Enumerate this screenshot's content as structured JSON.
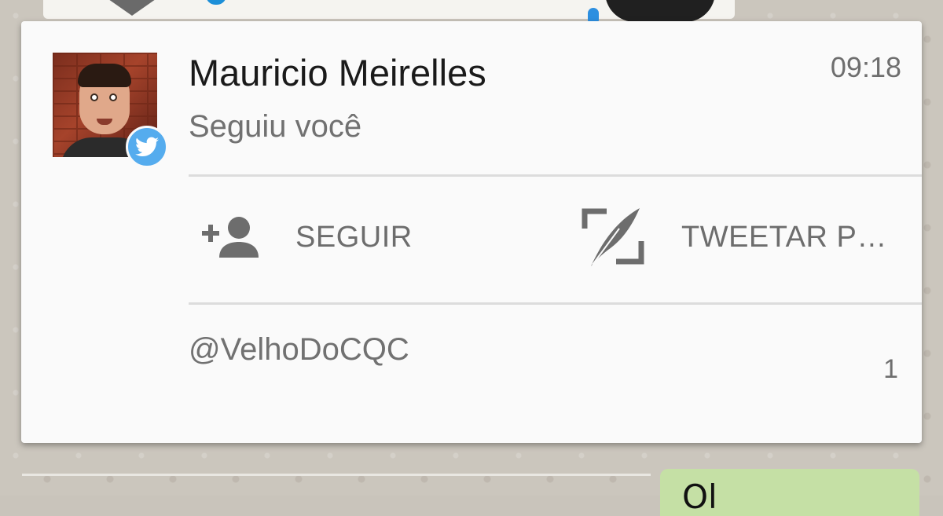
{
  "notification": {
    "title": "Mauricio Meirelles",
    "time": "09:18",
    "subtitle": "Seguiu você",
    "handle": "@VelhoDoCQC",
    "count": "1",
    "app_badge_icon": "twitter-bird-icon",
    "avatar_icon": "profile-photo"
  },
  "actions": [
    {
      "label": "SEGUIR",
      "icon": "add-person-icon"
    },
    {
      "label": "TWEETAR P…",
      "icon": "compose-quill-icon"
    }
  ],
  "background": {
    "bubble_text": "Ol"
  },
  "colors": {
    "card_bg": "#fafafa",
    "twitter_blue": "#55acee",
    "title_text": "#1a1a1a",
    "secondary_text": "#717171",
    "icon_gray": "#6d6d6d",
    "divider": "#dcdcdc"
  }
}
